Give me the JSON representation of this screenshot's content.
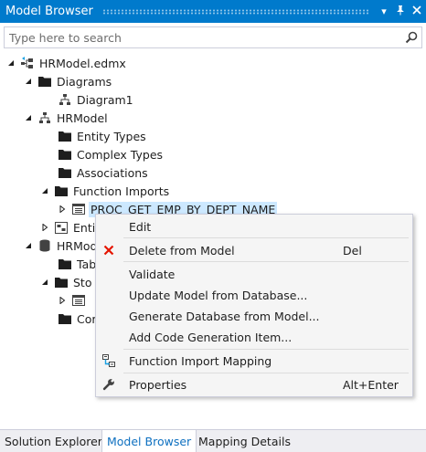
{
  "window": {
    "title": "Model Browser",
    "pin_icon": "pin-icon",
    "close_icon": "close-icon"
  },
  "search": {
    "placeholder": "Type here to search",
    "icon": "search-icon"
  },
  "tree": {
    "root": "HRModel.edmx",
    "diagrams": "Diagrams",
    "diagram1": "Diagram1",
    "hrmodel": "HRModel",
    "entity_types": "Entity Types",
    "complex_types": "Complex Types",
    "associations": "Associations",
    "function_imports": "Function Imports",
    "proc": "PROC_GET_EMP_BY_DEPT_NAME",
    "entity_container_partial": "Enti",
    "store_partial": "HRMod",
    "tables_partial": "Tab",
    "sto_partial": "Sto",
    "con_partial": "Cor"
  },
  "context_menu": {
    "items": [
      {
        "label": "Edit",
        "shortcut": ""
      },
      {
        "label": "Delete from Model",
        "shortcut": "Del",
        "icon": "delete-x-icon"
      },
      {
        "label": "Validate",
        "shortcut": ""
      },
      {
        "label": "Update Model from Database...",
        "shortcut": ""
      },
      {
        "label": "Generate Database from Model...",
        "shortcut": ""
      },
      {
        "label": "Add Code Generation Item...",
        "shortcut": ""
      },
      {
        "label": "Function Import Mapping",
        "shortcut": "",
        "icon": "mapping-icon"
      },
      {
        "label": "Properties",
        "shortcut": "Alt+Enter",
        "icon": "wrench-icon"
      }
    ]
  },
  "bottom_tabs": [
    {
      "label": "Solution Explorer",
      "active": false
    },
    {
      "label": "Model Browser",
      "active": true
    },
    {
      "label": "Mapping Details",
      "active": false
    }
  ],
  "colors": {
    "accent": "#007acc",
    "selection": "#cce8ff",
    "delete_red": "#e51400",
    "active_tab_text": "#0e70c0"
  }
}
